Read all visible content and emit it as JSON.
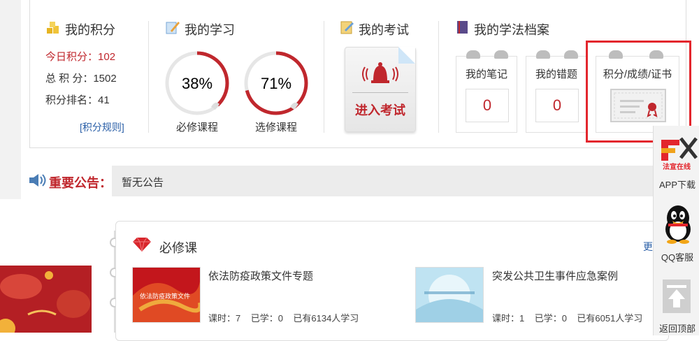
{
  "points": {
    "title": "我的积分",
    "today_label": "今日积分：",
    "today_value": "102",
    "total_label": "总 积 分：",
    "total_value": "1502",
    "rank_label": "积分排名：",
    "rank_value": "41",
    "rules_link": "[积分规则]"
  },
  "study": {
    "title": "我的学习",
    "required": {
      "percent_text": "38%",
      "progress": 0.38,
      "label": "必修课程"
    },
    "elective": {
      "percent_text": "71%",
      "progress": 0.71,
      "label": "选修课程"
    }
  },
  "exam": {
    "title": "我的考试",
    "button_label": "进入考试"
  },
  "archive": {
    "title": "我的学法档案",
    "notes": {
      "label": "我的笔记",
      "value": "0"
    },
    "wrong": {
      "label": "我的错题",
      "value": "0"
    },
    "cert": {
      "label": "积分/成绩/证书"
    }
  },
  "notice": {
    "label": "重要公告：",
    "text": "暂无公告"
  },
  "courses": {
    "section_title": "必修课",
    "more_label": "更",
    "items": [
      {
        "title": "依法防疫政策文件专题",
        "hours_label": "课时：7",
        "learned_label": "已学：0",
        "count_label": "已有6134人学习",
        "thumb_text": "依法防疫政策文件"
      },
      {
        "title": "突发公共卫生事件应急案例",
        "hours_label": "课时：1",
        "learned_label": "已学：0",
        "count_label": "已有6051人学习"
      }
    ]
  },
  "side": {
    "app_label": "APP下载",
    "qq_label": "QQ客服",
    "top_label": "返回顶部",
    "logo_text": "法宣在线"
  },
  "colors": {
    "accent": "#c0272d",
    "highlight": "#e3262d",
    "link": "#2a5fa7"
  }
}
